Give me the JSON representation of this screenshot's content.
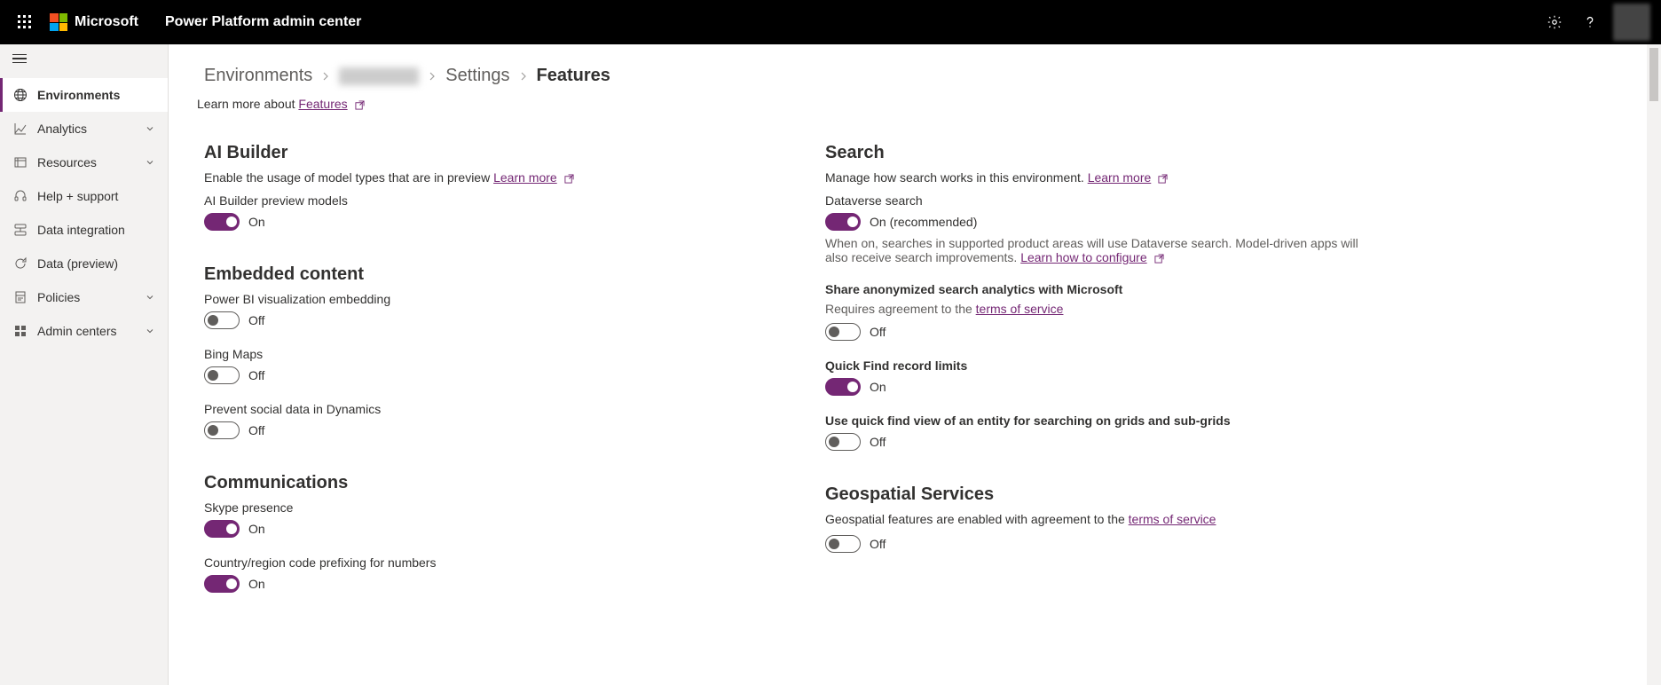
{
  "header": {
    "brand": "Microsoft",
    "product": "Power Platform admin center"
  },
  "sidebar": {
    "items": [
      {
        "label": "Environments",
        "icon": "globe",
        "active": true,
        "expandable": false
      },
      {
        "label": "Analytics",
        "icon": "chart",
        "active": false,
        "expandable": true
      },
      {
        "label": "Resources",
        "icon": "resources",
        "active": false,
        "expandable": true
      },
      {
        "label": "Help + support",
        "icon": "headset",
        "active": false,
        "expandable": false
      },
      {
        "label": "Data integration",
        "icon": "data-int",
        "active": false,
        "expandable": false
      },
      {
        "label": "Data (preview)",
        "icon": "refresh",
        "active": false,
        "expandable": false
      },
      {
        "label": "Policies",
        "icon": "policies",
        "active": false,
        "expandable": true
      },
      {
        "label": "Admin centers",
        "icon": "admin",
        "active": false,
        "expandable": true
      }
    ]
  },
  "breadcrumb": {
    "root": "Environments",
    "settings": "Settings",
    "current": "Features"
  },
  "learnMore": {
    "prefix": "Learn more about ",
    "link": "Features"
  },
  "left": {
    "aiBuilder": {
      "title": "AI Builder",
      "desc": "Enable the usage of model types that are in preview ",
      "descLink": "Learn more",
      "items": [
        {
          "label": "AI Builder preview models",
          "on": true,
          "stateText": "On"
        }
      ]
    },
    "embedded": {
      "title": "Embedded content",
      "items": [
        {
          "label": "Power BI visualization embedding",
          "on": false,
          "stateText": "Off"
        },
        {
          "label": "Bing Maps",
          "on": false,
          "stateText": "Off"
        },
        {
          "label": "Prevent social data in Dynamics",
          "on": false,
          "stateText": "Off"
        }
      ]
    },
    "comms": {
      "title": "Communications",
      "items": [
        {
          "label": "Skype presence",
          "on": true,
          "stateText": "On"
        },
        {
          "label": "Country/region code prefixing for numbers",
          "on": true,
          "stateText": "On"
        }
      ]
    }
  },
  "right": {
    "search": {
      "title": "Search",
      "desc": "Manage how search works in this environment. ",
      "descLink": "Learn more",
      "dataverse": {
        "label": "Dataverse search",
        "on": true,
        "stateText": "On (recommended)",
        "help": "When on, searches in supported product areas will use Dataverse search. Model-driven apps will also receive search improvements. ",
        "helpLink": "Learn how to configure"
      },
      "analytics": {
        "label": "Share anonymized search analytics with Microsoft",
        "sublabel": "Requires agreement to the ",
        "sublabelLink": "terms of service",
        "on": false,
        "stateText": "Off"
      },
      "quickFind": {
        "label": "Quick Find record limits",
        "on": true,
        "stateText": "On"
      },
      "quickFindView": {
        "label": "Use quick find view of an entity for searching on grids and sub-grids",
        "on": false,
        "stateText": "Off"
      }
    },
    "geo": {
      "title": "Geospatial Services",
      "desc": "Geospatial features are enabled with agreement to the ",
      "descLink": "terms of service",
      "on": false,
      "stateText": "Off"
    }
  }
}
